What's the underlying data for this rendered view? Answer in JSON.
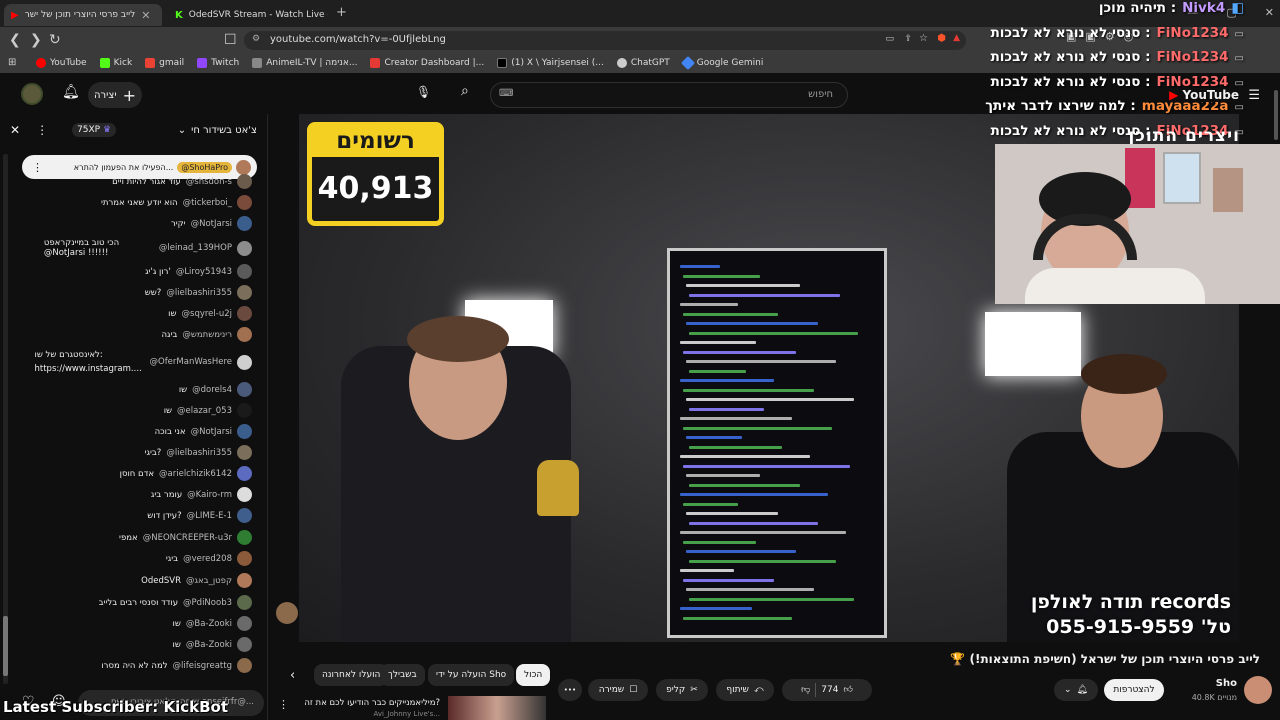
{
  "browser": {
    "tabs": [
      {
        "label": "לייב פרסי היוצרי תוכן של ישר",
        "icon": "youtube-icon",
        "color": "#ff0000"
      },
      {
        "label": "OdedSVR Stream - Watch Live on Ki",
        "icon": "kick-icon",
        "color": "#53fc18"
      }
    ],
    "new_tab": "+",
    "url": "youtube.com/watch?v=-0UfjlebLng",
    "bookmarks": [
      {
        "label": "YouTube",
        "color": "#ff0000"
      },
      {
        "label": "Kick",
        "color": "#53fc18"
      },
      {
        "label": "gmail",
        "color": "#ea4335"
      },
      {
        "label": "Twitch",
        "color": "#9146ff"
      },
      {
        "label": "AnimeIL-TV | אנימה...",
        "color": "#888888"
      },
      {
        "label": "Creator Dashboard |...",
        "color": "#e53935"
      },
      {
        "label": "(1) X \\ Yairjsensei (...",
        "color": "#000000"
      },
      {
        "label": "ChatGPT",
        "color": "#cccccc"
      },
      {
        "label": "Google Gemini",
        "color": "#4285f4"
      }
    ]
  },
  "yt": {
    "create_label": "יצירה",
    "search_placeholder": "חיפוש"
  },
  "chat": {
    "title": "צ'אט בשידור חי",
    "xp": "75XP",
    "pinned": {
      "handle": "@ShoHaPro",
      "text": "הפעילו את הפעמון להתרא..."
    },
    "messages": [
      {
        "user": "@shsdon-s",
        "text": "עוד אגור להיות ויים",
        "color": "#6b5b4a"
      },
      {
        "user": "@tickerboi_",
        "text": "הוא יודע שאני אמרתי",
        "color": "#7a4a3a"
      },
      {
        "user": "@NotJarsi",
        "text": "יקיר",
        "color": "#3b5d8c"
      },
      {
        "user": "@leinad_139HOP",
        "text": "הכי טוב במיינקראפט @NotJarsi !!!!!!",
        "color": "#8c8c8c"
      },
      {
        "user": "@Liroy51943",
        "text": "רון ג'יג'",
        "color": "#5a5a5a"
      },
      {
        "user": "@lielbashiri355",
        "text": "שש?",
        "color": "#7b6e5a"
      },
      {
        "user": "@sqyrel-u2j",
        "text": "שו",
        "color": "#6a4a3f"
      },
      {
        "user": "@רינימשתמש",
        "text": "ביגה",
        "color": "#a07050"
      },
      {
        "user": "@OferManWasHere",
        "text": "לאינסטגרם של שו: https://www.instagram.com/shohapro",
        "color": "#cfcfcf"
      },
      {
        "user": "@dorels4",
        "text": "שו",
        "color": "#4a5a7a"
      },
      {
        "user": "@elazar_053",
        "text": "שו",
        "color": "#1a1a1a"
      },
      {
        "user": "@NotJarsi",
        "text": "אני בוכה",
        "color": "#3b5d8c"
      },
      {
        "user": "@lielbashiri355",
        "text": "ביגי?",
        "color": "#7b6e5a"
      },
      {
        "user": "@arielchizik6142",
        "text": "אדם חוסן",
        "color": "#5c6bc0"
      },
      {
        "user": "@Kairo-rm",
        "text": "עומר ביג",
        "color": "#dddddd"
      },
      {
        "user": "@LIME-E-1",
        "text": "עידן דוש?",
        "color": "#3f5e8c"
      },
      {
        "user": "@NEONCREEPER-u3r",
        "text": "אמפי",
        "color": "#2e7d32"
      },
      {
        "user": "@vered208",
        "text": "ביגי",
        "color": "#8a5a3a"
      },
      {
        "user": "@קפטן_באג",
        "text": "OdedSVR",
        "color": "#b07a5a"
      },
      {
        "user": "@PdiNoob3",
        "text": "עודד וסנסי רבים בלייב",
        "color": "#5a6a4a"
      },
      {
        "user": "@Ba-Zooki",
        "text": "שו",
        "color": "#6a6a6a"
      },
      {
        "user": "@Ba-Zooki",
        "text": "שו",
        "color": "#6a6a6a"
      },
      {
        "user": "@lifeisgreattg",
        "text": "למה לא היה מסרו",
        "color": "#8a6a4a"
      }
    ],
    "input_placeholder": "שיחה בצ'אט ציבורי בשם enseifrfr@..."
  },
  "video": {
    "sign_title": "רשומים",
    "sign_count": "40,913",
    "records_line1": "תודה לאולפן records",
    "records_line2": "טל' 055-915-9559"
  },
  "overlay": {
    "lines": [
      {
        "user": "Nivk4",
        "text": "תיהיה מוכן :",
        "color": "#c39bff"
      },
      {
        "user": "FiNo1234",
        "text": "סנסי לא נורא לא לבכות :",
        "color": "#ff6a6a"
      },
      {
        "user": "FiNo1234",
        "text": "סנסי לא נורא לא לבכות :",
        "color": "#ff6a6a"
      },
      {
        "user": "FiNo1234",
        "text": "סנסי לא נורא לא לבכות :",
        "color": "#ff6a6a"
      },
      {
        "user": "mayaaa22a",
        "text": "למה שירצו לדבר איתך :",
        "color": "#ff8c3a"
      },
      {
        "user": "FiNo1234",
        "text": "סנסי לא נורא לא לבכות :",
        "color": "#ff6a6a"
      }
    ],
    "youtube_label": "YouTube",
    "ticker": "Latest Subscriber: KickBot"
  },
  "meta": {
    "title": "🏆 לייב פרסי היוצרי תוכן של ישראל (חשיפת התוצאות!)",
    "channel": "Sho",
    "subscribers": "40.8K מנויים",
    "subscribe": "להצטרפות",
    "likes": "774",
    "share": "שיתוף",
    "clip": "קליפ",
    "save": "שמירה",
    "more": "•••",
    "filters": [
      "הכול",
      "הועלה על ידי Sho",
      "בשבילך",
      "הועלו לאחרונה"
    ],
    "rec_title": "מיליאמנייקים כבר הודיעו לכם את זה?",
    "rec_channel": "Avi_Johnny Live's..."
  }
}
